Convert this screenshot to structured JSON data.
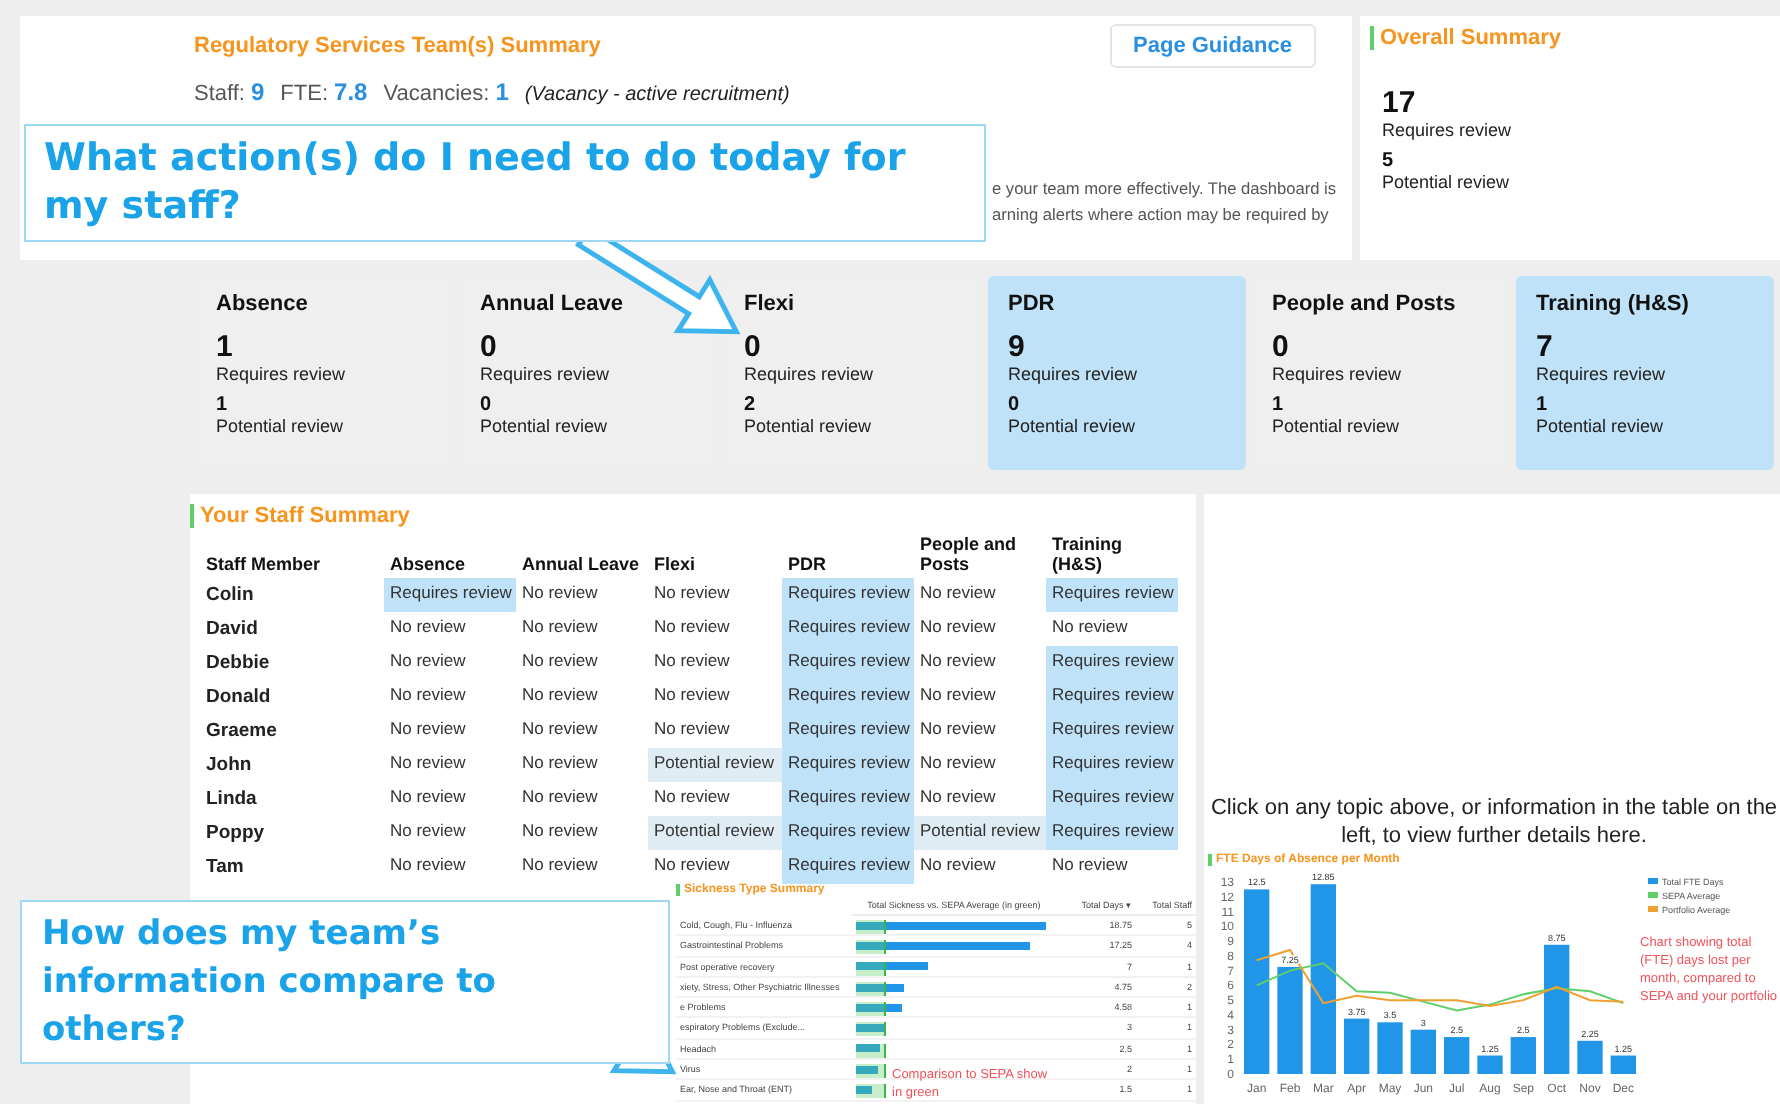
{
  "header": {
    "title": "Regulatory Services Team(s) Summary",
    "stats": [
      {
        "label": "Staff:",
        "value": "9"
      },
      {
        "label": "FTE:",
        "value": "7.8"
      },
      {
        "label": "Vacancies:",
        "value": "1"
      }
    ],
    "vacancy_note": "(Vacancy - active recruitment)",
    "guidance_button": "Page Guidance",
    "intro_lines": [
      "e your team more effectively. The dashboard is",
      "arning alerts where action may be required by"
    ]
  },
  "overall_summary": {
    "title": "Overall Summary",
    "requires_count": "17",
    "requires_label": "Requires review",
    "potential_count": "5",
    "potential_label": "Potential review"
  },
  "cards": [
    {
      "title": "Absence",
      "requires_count": "1",
      "requires_label": "Requires review",
      "potential_count": "1",
      "potential_label": "Potential review",
      "highlighted": false
    },
    {
      "title": "Annual Leave",
      "requires_count": "0",
      "requires_label": "Requires review",
      "potential_count": "0",
      "potential_label": "Potential review",
      "highlighted": false
    },
    {
      "title": "Flexi",
      "requires_count": "0",
      "requires_label": "Requires review",
      "potential_count": "2",
      "potential_label": "Potential review",
      "highlighted": false
    },
    {
      "title": "PDR",
      "requires_count": "9",
      "requires_label": "Requires review",
      "potential_count": "0",
      "potential_label": "Potential review",
      "highlighted": true
    },
    {
      "title": "People and Posts",
      "requires_count": "0",
      "requires_label": "Requires review",
      "potential_count": "1",
      "potential_label": "Potential review",
      "highlighted": false
    },
    {
      "title": "Training (H&S)",
      "requires_count": "7",
      "requires_label": "Requires review",
      "potential_count": "1",
      "potential_label": "Potential review",
      "highlighted": true
    }
  ],
  "staff_summary": {
    "title": "Your Staff Summary",
    "columns": [
      "Staff Member",
      "Absence",
      "Annual Leave",
      "Flexi",
      "PDR",
      "People and Posts",
      "Training (H&S)"
    ],
    "rows": [
      {
        "cells": [
          {
            "text": "Colin",
            "kind": "name"
          },
          {
            "text": "Requires review",
            "kind": "requires"
          },
          {
            "text": "No review",
            "kind": "none"
          },
          {
            "text": "No review",
            "kind": "none"
          },
          {
            "text": "Requires review",
            "kind": "requires"
          },
          {
            "text": "No review",
            "kind": "none"
          },
          {
            "text": "Requires review",
            "kind": "requires"
          }
        ]
      },
      {
        "cells": [
          {
            "text": "David",
            "kind": "name"
          },
          {
            "text": "No review",
            "kind": "none"
          },
          {
            "text": "No review",
            "kind": "none"
          },
          {
            "text": "No review",
            "kind": "none"
          },
          {
            "text": "Requires review",
            "kind": "requires"
          },
          {
            "text": "No review",
            "kind": "none"
          },
          {
            "text": "No review",
            "kind": "none"
          }
        ]
      },
      {
        "cells": [
          {
            "text": "Debbie",
            "kind": "name"
          },
          {
            "text": "No review",
            "kind": "none"
          },
          {
            "text": "No review",
            "kind": "none"
          },
          {
            "text": "No review",
            "kind": "none"
          },
          {
            "text": "Requires review",
            "kind": "requires"
          },
          {
            "text": "No review",
            "kind": "none"
          },
          {
            "text": "Requires review",
            "kind": "requires"
          }
        ]
      },
      {
        "cells": [
          {
            "text": "Donald",
            "kind": "name"
          },
          {
            "text": "No review",
            "kind": "none"
          },
          {
            "text": "No review",
            "kind": "none"
          },
          {
            "text": "No review",
            "kind": "none"
          },
          {
            "text": "Requires review",
            "kind": "requires"
          },
          {
            "text": "No review",
            "kind": "none"
          },
          {
            "text": "Requires review",
            "kind": "requires"
          }
        ]
      },
      {
        "cells": [
          {
            "text": "Graeme",
            "kind": "name"
          },
          {
            "text": "No review",
            "kind": "none"
          },
          {
            "text": "No review",
            "kind": "none"
          },
          {
            "text": "No review",
            "kind": "none"
          },
          {
            "text": "Requires review",
            "kind": "requires"
          },
          {
            "text": "No review",
            "kind": "none"
          },
          {
            "text": "Requires review",
            "kind": "requires"
          }
        ]
      },
      {
        "cells": [
          {
            "text": "John",
            "kind": "name"
          },
          {
            "text": "No review",
            "kind": "none"
          },
          {
            "text": "No review",
            "kind": "none"
          },
          {
            "text": "Potential review",
            "kind": "potential"
          },
          {
            "text": "Requires review",
            "kind": "requires"
          },
          {
            "text": "No review",
            "kind": "none"
          },
          {
            "text": "Requires review",
            "kind": "requires"
          }
        ]
      },
      {
        "cells": [
          {
            "text": "Linda",
            "kind": "name"
          },
          {
            "text": "No review",
            "kind": "none"
          },
          {
            "text": "No review",
            "kind": "none"
          },
          {
            "text": "No review",
            "kind": "none"
          },
          {
            "text": "Requires review",
            "kind": "requires"
          },
          {
            "text": "No review",
            "kind": "none"
          },
          {
            "text": "Requires review",
            "kind": "requires"
          }
        ]
      },
      {
        "cells": [
          {
            "text": "Poppy",
            "kind": "name"
          },
          {
            "text": "No review",
            "kind": "none"
          },
          {
            "text": "No review",
            "kind": "none"
          },
          {
            "text": "Potential review",
            "kind": "potential"
          },
          {
            "text": "Requires review",
            "kind": "requires"
          },
          {
            "text": "Potential review",
            "kind": "potential"
          },
          {
            "text": "Requires review",
            "kind": "requires"
          }
        ]
      },
      {
        "cells": [
          {
            "text": "Tam",
            "kind": "name"
          },
          {
            "text": "No review",
            "kind": "none"
          },
          {
            "text": "No review",
            "kind": "none"
          },
          {
            "text": "No review",
            "kind": "none"
          },
          {
            "text": "Requires review",
            "kind": "requires"
          },
          {
            "text": "No review",
            "kind": "none"
          },
          {
            "text": "No review",
            "kind": "none"
          }
        ]
      }
    ]
  },
  "details_hint": "Click on any topic above, or information in the table on the left, to view further details here.",
  "sickness_summary": {
    "title": "Sickness Type Summary",
    "columns": [
      "Total Sickness vs. SEPA Average (in green)",
      "Total Days ▾",
      "Total Staff"
    ],
    "rows": [
      {
        "type": "Cold, Cough, Flu - Influenza",
        "level": 0.99,
        "days": "18.75",
        "staff": "5"
      },
      {
        "type": "Gastrointestinal Problems",
        "level": 0.91,
        "days": "17.25",
        "staff": "4"
      },
      {
        "type": "Post operative recovery",
        "level": 0.37,
        "days": "7",
        "staff": "1"
      },
      {
        "type": "xiety, Stress, Other Psychiatric Illnesses",
        "level": 0.25,
        "days": "4.75",
        "staff": "2"
      },
      {
        "type": "e Problems",
        "level": 0.24,
        "days": "4.58",
        "staff": "1"
      },
      {
        "type": "espiratory Problems (Exclude...",
        "level": 0.16,
        "days": "3",
        "staff": "1"
      },
      {
        "type": "Headach",
        "level": 0.13,
        "days": "2.5",
        "staff": "1"
      },
      {
        "type": "Virus",
        "level": 0.11,
        "days": "2",
        "staff": "1"
      },
      {
        "type": "Ear, Nose and Throat (ENT)",
        "level": 0.08,
        "days": "1.5",
        "staff": "1"
      }
    ],
    "note": "Comparison to SEPA show in green"
  },
  "absence_chart": {
    "title": "FTE Days of Absence per Month",
    "note": "Chart showing total (FTE) days lost per month, compared to SEPA and your portfolio",
    "chart_data": {
      "type": "bar",
      "categories": [
        "Jan",
        "Feb",
        "Mar",
        "Apr",
        "May",
        "Jun",
        "Jul",
        "Aug",
        "Sep",
        "Oct",
        "Nov",
        "Dec"
      ],
      "ylim": [
        0,
        13
      ],
      "yticks": [
        0,
        1,
        2,
        3,
        4,
        5,
        6,
        7,
        8,
        9,
        10,
        11,
        12,
        13
      ],
      "legend": "right",
      "value_labels": [
        [
          "12.5",
          "7.25",
          "12.85",
          "3.75",
          "3.5",
          "3",
          "2.5",
          "1.25",
          "2.5",
          "8.75",
          "2.25",
          "1.25"
        ],
        [
          null,
          null,
          null,
          null,
          null,
          null,
          null,
          null,
          null,
          null,
          null,
          null
        ],
        [
          null,
          null,
          null,
          null,
          null,
          null,
          null,
          null,
          null,
          null,
          null,
          null
        ]
      ],
      "series": [
        {
          "name": "Total FTE Days",
          "type": "bar",
          "color": "#2196e8",
          "values": [
            12.5,
            7.25,
            12.85,
            3.75,
            3.5,
            3,
            2.5,
            1.25,
            2.5,
            8.75,
            2.25,
            1.25
          ]
        },
        {
          "name": "SEPA Average",
          "type": "line",
          "color": "#5fcf6a",
          "values": [
            6,
            7,
            7.5,
            5.6,
            5.5,
            4.9,
            4.3,
            4.7,
            5.4,
            5.8,
            5.6,
            4.8
          ]
        },
        {
          "name": "Portfolio Average",
          "type": "line",
          "color": "#f0a030",
          "values": [
            7.7,
            8.4,
            4.8,
            5.3,
            5,
            5,
            5,
            4.6,
            5,
            5.9,
            5,
            4.9
          ]
        }
      ]
    }
  },
  "callouts": [
    "What action(s) do I need to do today for my staff?",
    "How does my team’s information compare to others?"
  ]
}
